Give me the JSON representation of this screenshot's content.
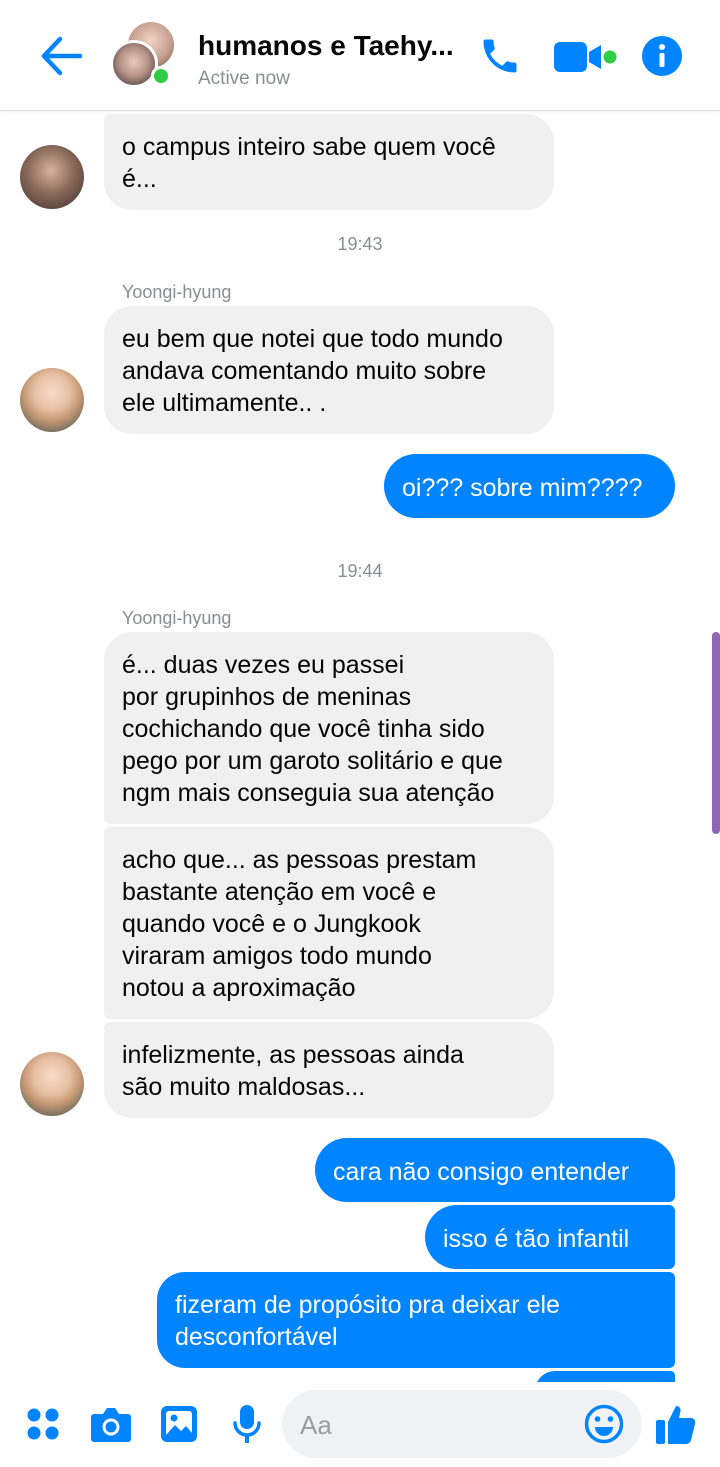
{
  "header": {
    "title": "humanos e Taehy...",
    "status": "Active now"
  },
  "messages": {
    "m1": "o campus inteiro sabe quem você\né...",
    "time1": "19:43",
    "sender1": "Yoongi-hyung",
    "m2": "eu bem que notei que todo mundo\nandava comentando muito sobre\nele ultimamente.. .",
    "m3": "oi??? sobre mim????",
    "time2": "19:44",
    "sender2": "Yoongi-hyung",
    "m4": "é... duas vezes eu passei\npor grupinhos de meninas\ncochichando que você tinha sido\npego por um garoto solitário e que\nngm mais conseguia sua atenção",
    "m5": "acho que... as pessoas prestam\nbastante atenção em você e\nquando você e o Jungkook\nviraram amigos todo mundo\nnotou a aproximação",
    "m6": "infelizmente, as pessoas ainda\nsão muito maldosas...",
    "m7": "cara não consigo entender",
    "m8": "isso é tão infantil",
    "m9": "fizeram de propósito pra deixar ele\ndesconfortável"
  },
  "composer": {
    "placeholder": "Aa"
  },
  "colors": {
    "accent": "#0084ff",
    "bubble_in": "#f0f0f0",
    "online": "#31cc46"
  },
  "icons": [
    "back-arrow-icon",
    "phone-icon",
    "video-icon",
    "info-icon",
    "apps-icon",
    "camera-icon",
    "gallery-icon",
    "microphone-icon",
    "emoji-icon",
    "thumbs-up-icon"
  ]
}
